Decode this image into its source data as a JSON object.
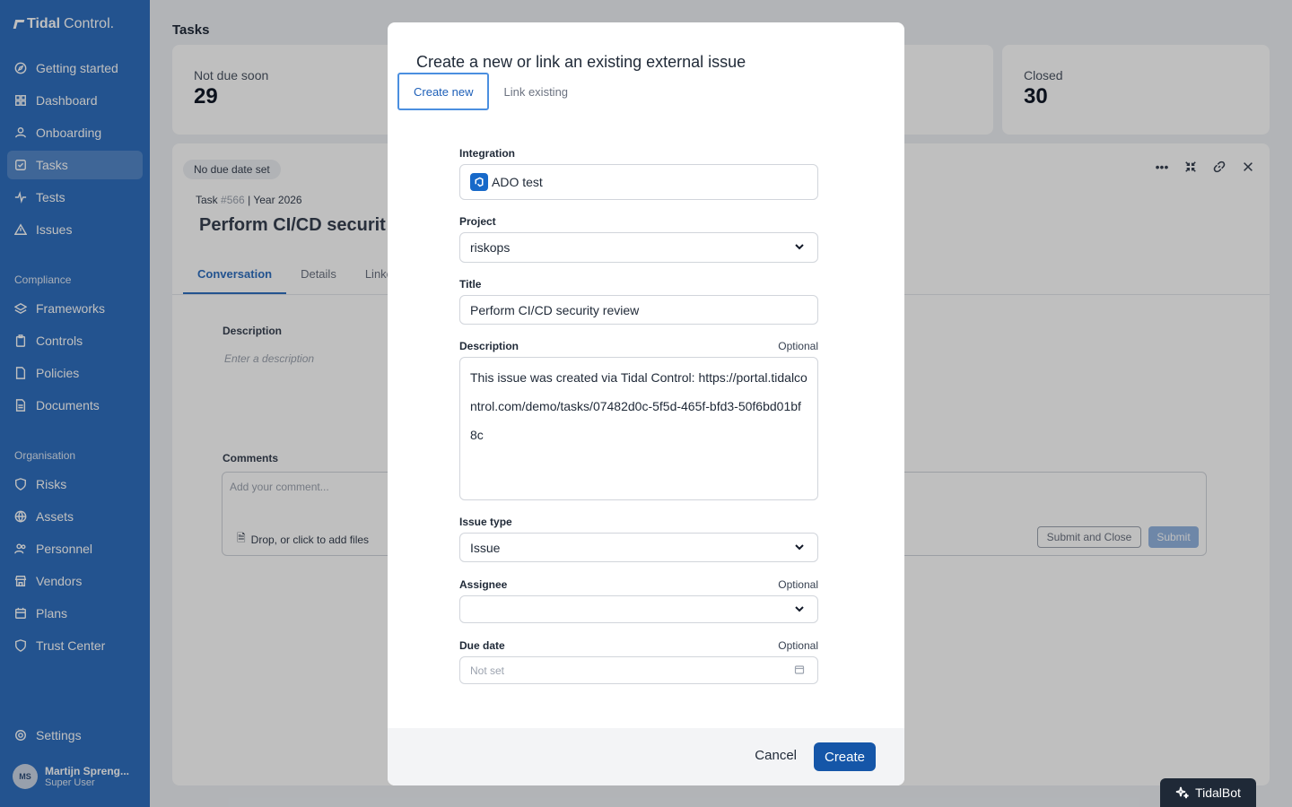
{
  "app": {
    "logo_bold": "Tidal",
    "logo_rest": "Control."
  },
  "sidebar": {
    "items": [
      {
        "label": "Getting started",
        "icon": "compass-icon"
      },
      {
        "label": "Dashboard",
        "icon": "grid-icon"
      },
      {
        "label": "Onboarding",
        "icon": "user-icon"
      },
      {
        "label": "Tasks",
        "icon": "checkbox-icon",
        "active": true
      },
      {
        "label": "Tests",
        "icon": "pulse-icon"
      },
      {
        "label": "Issues",
        "icon": "warning-icon"
      }
    ],
    "compliance_label": "Compliance",
    "compliance": [
      {
        "label": "Frameworks",
        "icon": "layers-icon"
      },
      {
        "label": "Controls",
        "icon": "clipboard-icon"
      },
      {
        "label": "Policies",
        "icon": "file-icon"
      },
      {
        "label": "Documents",
        "icon": "document-icon"
      }
    ],
    "organisation_label": "Organisation",
    "organisation": [
      {
        "label": "Risks",
        "icon": "shield-icon"
      },
      {
        "label": "Assets",
        "icon": "globe-icon"
      },
      {
        "label": "Personnel",
        "icon": "users-icon"
      },
      {
        "label": "Vendors",
        "icon": "store-icon"
      },
      {
        "label": "Plans",
        "icon": "calendar-icon"
      },
      {
        "label": "Trust Center",
        "icon": "shield-check-icon"
      }
    ],
    "settings": "Settings",
    "user": {
      "initials": "MS",
      "name": "Martijn Spreng...",
      "role": "Super User"
    }
  },
  "main": {
    "title": "Tasks",
    "stats": [
      {
        "label": "Not due soon",
        "value": "29"
      },
      {
        "label": "Closed",
        "value": "30"
      }
    ],
    "task": {
      "chip": "No due date set",
      "meta_prefix": "Task",
      "meta_id": "#566",
      "meta_year": "Year 2026",
      "title": "Perform CI/CD securit",
      "tabs": [
        "Conversation",
        "Details",
        "Linke"
      ],
      "description_label": "Description",
      "description_placeholder": "Enter a description",
      "comments_label": "Comments",
      "comment_placeholder": "Add your comment...",
      "drop_files": "Drop, or click to add files",
      "submit_close": "Submit and Close",
      "submit": "Submit"
    }
  },
  "modal": {
    "title": "Create a new or link an existing external issue",
    "tabs": [
      "Create new",
      "Link existing"
    ],
    "integration_label": "Integration",
    "integration_value": "ADO test",
    "project_label": "Project",
    "project_value": "riskops",
    "title_label": "Title",
    "title_value": "Perform CI/CD security review",
    "description_label": "Description",
    "optional": "Optional",
    "description_value": "This issue was created via Tidal Control: https://portal.tidalcontrol.com/demo/tasks/07482d0c-5f5d-465f-bfd3-50f6bd01bf8c",
    "issue_type_label": "Issue type",
    "issue_type_value": "Issue",
    "assignee_label": "Assignee",
    "assignee_value": "",
    "due_date_label": "Due date",
    "due_date_placeholder": "Not set",
    "cancel": "Cancel",
    "create": "Create"
  },
  "tidalbot": "TidalBot"
}
